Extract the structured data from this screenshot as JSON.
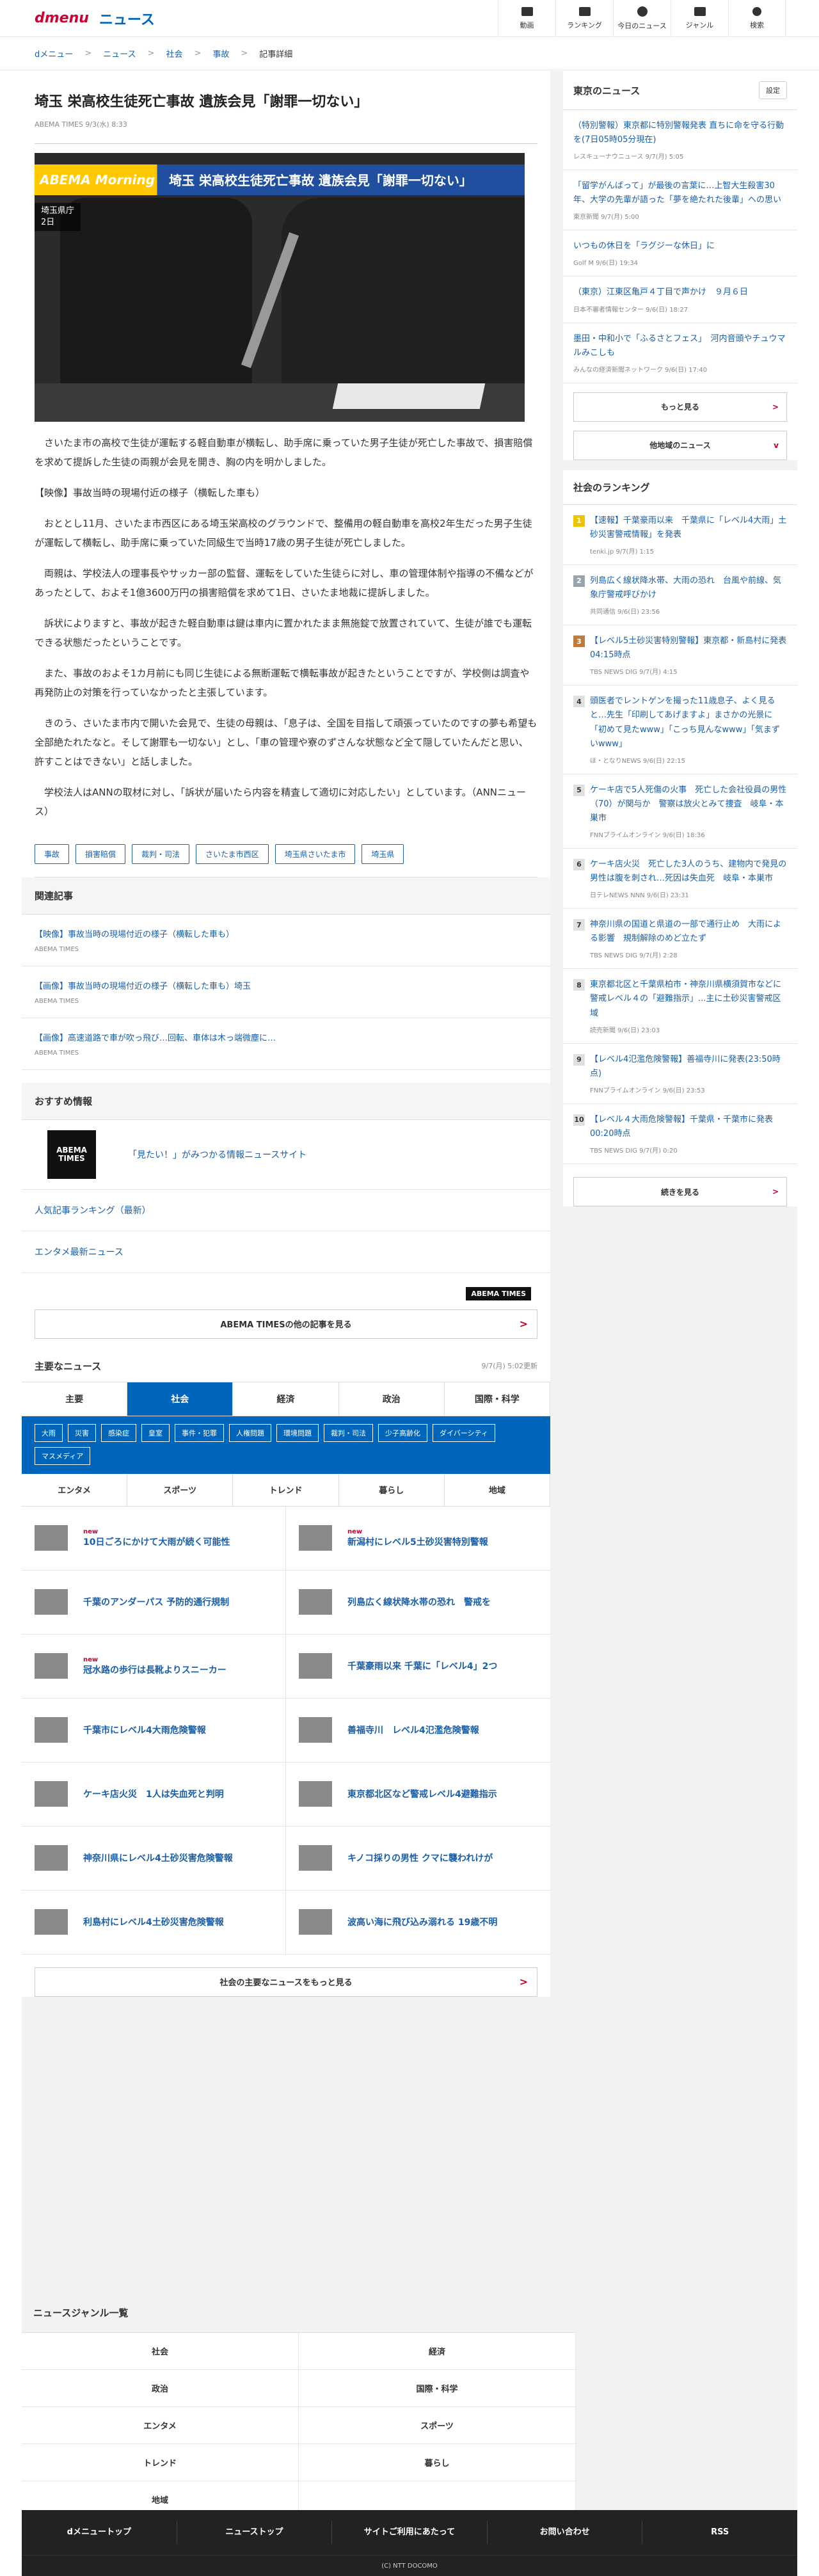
{
  "header": {
    "brand": "dmenu",
    "section": "ニュース",
    "nav": [
      "動画",
      "ランキング",
      "今日のニュース",
      "ジャンル",
      "検索"
    ]
  },
  "breadcrumb": [
    "dメニュー",
    "ニュース",
    "社会",
    "事故",
    "記事詳細"
  ],
  "article": {
    "title": "埼玉 栄高校生徒死亡事故 遺族会見「謝罪一切ない」",
    "meta": "ABEMA TIMES 9/3(水) 8:33",
    "hero": {
      "brand": "ABEMA Morning",
      "headline": "埼玉 栄高校生徒死亡事故 遺族会見「謝罪一切ない」",
      "caption": "埼玉県庁\n2日"
    },
    "paragraphs": [
      "さいたま市の高校で生徒が運転する軽自動車が横転し、助手席に乗っていた男子生徒が死亡した事故で、損害賠償を求めて提訴した生徒の両親が会見を開き、胸の内を明かしました。",
      "【映像】事故当時の現場付近の様子（横転した車も）",
      "おととし11月、さいたま市西区にある埼玉栄高校のグラウンドで、整備用の軽自動車を高校2年生だった男子生徒が運転して横転し、助手席に乗っていた同級生で当時17歳の男子生徒が死亡しました。",
      "両親は、学校法人の理事長やサッカー部の監督、運転をしていた生徒らに対し、車の管理体制や指導の不備などがあったとして、およそ1億3600万円の損害賠償を求めて1日、さいたま地裁に提訴しました。",
      "訴状によりますと、事故が起きた軽自動車は鍵は車内に置かれたまま無施錠で放置されていて、生徒が誰でも運転できる状態だったということです。",
      "また、事故のおよそ1カ月前にも同じ生徒による無断運転で横転事故が起きたということですが、学校側は調査や再発防止の対策を行っていなかったと主張しています。",
      "きのう、さいたま市内で開いた会見で、生徒の母親は、「息子は、全国を目指して頑張っていたのですの夢も希望も全部絶たれたなと。そして謝罪も一切ない」とし、「車の管理や寮のずさんな状態など全て隠していたんだと思い、許すことはできない」と話しました。",
      "学校法人はANNの取材に対し、「訴状が届いたら内容を精査して適切に対応したい」としています。（ANNニュース）"
    ],
    "tags": [
      "事故",
      "損害賠償",
      "裁判・司法",
      "さいたま市西区",
      "埼玉県さいたま市",
      "埼玉県"
    ]
  },
  "related": {
    "heading": "関連記事",
    "items": [
      {
        "title": "【映像】事故当時の現場付近の様子（横転した車も）",
        "source": "ABEMA TIMES"
      },
      {
        "title": "【画像】事故当時の現場付近の様子（横転した車も）埼玉",
        "source": "ABEMA TIMES"
      },
      {
        "title": "【画像】高速道路で車が吹っ飛び…回転、車体は木っ端微塵に…",
        "source": "ABEMA TIMES"
      }
    ]
  },
  "recommend": {
    "heading": "おすすめ情報",
    "abema_logo": "ABEMA\nTIMES",
    "site": "「見たい！」がみつかる情報ニュースサイト",
    "links": [
      "人気記事ランキング（最新）",
      "エンタメ最新ニュース"
    ],
    "brand_badge": "ABEMA TIMES",
    "more": "ABEMA TIMESの他の記事を見る"
  },
  "major": {
    "heading": "主要なニュース",
    "updated": "9/7(月) 5:02更新",
    "tabs": [
      "主要",
      "社会",
      "経済",
      "政治",
      "国際・科学"
    ],
    "chips": [
      "大雨",
      "災害",
      "感染症",
      "皇室",
      "事件・犯罪",
      "人権問題",
      "環境問題",
      "裁判・司法",
      "少子高齢化",
      "ダイバーシティ",
      "マスメディア"
    ],
    "tabs2": [
      "エンタメ",
      "スポーツ",
      "トレンド",
      "暮らし",
      "地域"
    ],
    "new_label": "new",
    "items": [
      {
        "t": "10日ごろにかけて大雨が続く可能性",
        "new": true
      },
      {
        "t": "新潟村にレベル5土砂災害特別警報",
        "new": true
      },
      {
        "t": "千葉のアンダーパス 予防的通行規制",
        "new": false
      },
      {
        "t": "列島広く線状降水帯の恐れ　警戒を",
        "new": false
      },
      {
        "t": "冠水路の歩行は長靴よりスニーカー",
        "new": true
      },
      {
        "t": "千葉豪雨以来 千葉に「レベル4」2つ",
        "new": false
      },
      {
        "t": "千葉市にレベル4大雨危険警報",
        "new": false
      },
      {
        "t": "善福寺川　レベル4氾濫危険警報",
        "new": false
      },
      {
        "t": "ケーキ店火災　1人は失血死と判明",
        "new": false
      },
      {
        "t": "東京都北区など警戒レベル4避難指示",
        "new": false
      },
      {
        "t": "神奈川県にレベル4土砂災害危険警報",
        "new": false
      },
      {
        "t": "キノコ採りの男性 クマに襲われけが",
        "new": false
      },
      {
        "t": "利島村にレベル4土砂災害危険警報",
        "new": false
      },
      {
        "t": "波高い海に飛び込み溺れる 19歳不明",
        "new": false
      }
    ],
    "more": "社会の主要なニュースをもっと見る"
  },
  "side_news": {
    "heading": "東京のニュース",
    "setting": "設定",
    "items": [
      {
        "t": "（特別警報）東京都に特別警報発表 直ちに命を守る行動を(7日05時05分現在)",
        "s": "レスキューナウニュース 9/7(月) 5:05"
      },
      {
        "t": "「留学がんばって」が最後の言葉に…上智大生殺害30年、大学の先輩が語った「夢を絶たれた後輩」への思い",
        "s": "東京新聞 9/7(月) 5:00"
      },
      {
        "t": "いつもの休日を「ラグジーな休日」に",
        "s": "Golf M 9/6(日) 19:34"
      },
      {
        "t": "（東京）江東区亀戸４丁目で声かけ　９月６日",
        "s": "日本不審者情報センター 9/6(日) 18:27"
      },
      {
        "t": "墨田・中和小で「ふるさとフェス」　河内音頭やチュウマルみこしも",
        "s": "みんなの経済新聞ネットワーク 9/6(日) 17:40"
      }
    ],
    "more": "もっと見る",
    "region": "他地域のニュース"
  },
  "ranking": {
    "heading": "社会のランキング",
    "items": [
      {
        "t": "【速報】千葉豪雨以来　千葉県に「レベル4大雨」土砂災害警戒情報」を発表",
        "s": "tenki.jp 9/7(月) 1:15"
      },
      {
        "t": "列島広く線状降水帯、大雨の恐れ　台風や前線、気象庁警戒呼びかけ",
        "s": "共同通信 9/6(日) 23:56"
      },
      {
        "t": "【レベル5土砂災害特別警報】東京都・新島村に発表 04:15時点",
        "s": "TBS NEWS DIG 9/7(月) 4:15"
      },
      {
        "t": "頭医者でレントゲンを撮った11歳息子、よく見ると…先生「印刷してあげますよ」まさかの光景に「初めて見たwww」「こっち見んなwww」「気まずいwww」",
        "s": "ほ・となりNEWS 9/6(日) 22:15"
      },
      {
        "t": "ケーキ店で5人死傷の火事　死亡した会社役員の男性（70）が関与か　警察は放火とみて捜査　岐阜・本巣市",
        "s": "FNNプライムオンライン 9/6(日) 18:36"
      },
      {
        "t": "ケーキ店火災　死亡した3人のうち、建物内で発見の男性は腹を刺され…死因は失血死　岐阜・本巣市",
        "s": "日テレNEWS NNN 9/6(日) 23:31"
      },
      {
        "t": "神奈川県の国道と県道の一部で通行止め　大雨による影響　規制解除のめど立たず",
        "s": "TBS NEWS DIG 9/7(月) 2:28"
      },
      {
        "t": "東京都北区と千葉県柏市・神奈川県横須賀市などに警戒レベル４の「避難指示」...主に土砂災害警戒区域",
        "s": "読売新聞 9/6(日) 23:03"
      },
      {
        "t": "【レベル4氾濫危険警報】善福寺川に発表(23:50時点)",
        "s": "FNNプライムオンライン 9/6(日) 23:53"
      },
      {
        "t": "【レベル４大雨危険警報】千葉県・千葉市に発表 00:20時点",
        "s": "TBS NEWS DIG 9/7(月) 0:20"
      }
    ],
    "more": "続きを見る"
  },
  "genre": {
    "heading": "ニュースジャンル一覧",
    "items": [
      "社会",
      "経済",
      "政治",
      "国際・科学",
      "エンタメ",
      "スポーツ",
      "トレンド",
      "暮らし",
      "地域",
      ""
    ]
  },
  "footer": {
    "links": [
      "dメニュートップ",
      "ニューストップ",
      "サイトご利用にあたって",
      "お問い合わせ",
      "RSS"
    ],
    "copyright": "(C) NTT DOCOMO"
  }
}
